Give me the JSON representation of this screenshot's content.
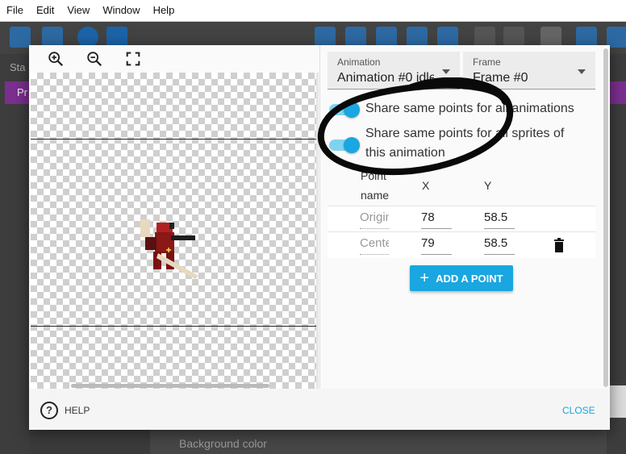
{
  "menubar": {
    "items": [
      "File",
      "Edit",
      "View",
      "Window",
      "Help"
    ]
  },
  "background": {
    "left_text": "Sta",
    "purple_text": "Pr",
    "bottom_label": "Background color"
  },
  "dialog": {
    "toolbar": {
      "zoom_in": "zoom-in-icon",
      "zoom_out": "zoom-out-icon",
      "fit": "fit-screen-icon"
    },
    "animation_select": {
      "label": "Animation",
      "value": "Animation #0 idle"
    },
    "frame_select": {
      "label": "Frame",
      "value": "Frame #0"
    },
    "toggles": {
      "share_all_animations": "Share same points for all animations",
      "share_all_sprites_line1": "Share same points for all sprites of",
      "share_all_sprites_line2": "this animation"
    },
    "table": {
      "headers": {
        "name_line1": "Point",
        "name_line2": "name",
        "x": "X",
        "y": "Y"
      },
      "rows": [
        {
          "name": "Origin",
          "x": "78",
          "y": "58.5"
        },
        {
          "name": "Center",
          "x": "79",
          "y": "58.5"
        }
      ]
    },
    "add_point_label": "ADD A POINT",
    "help_label": "HELP",
    "close_label": "CLOSE"
  },
  "colors": {
    "accent": "#1aa6e0",
    "toggle_track": "#80d3f0"
  }
}
